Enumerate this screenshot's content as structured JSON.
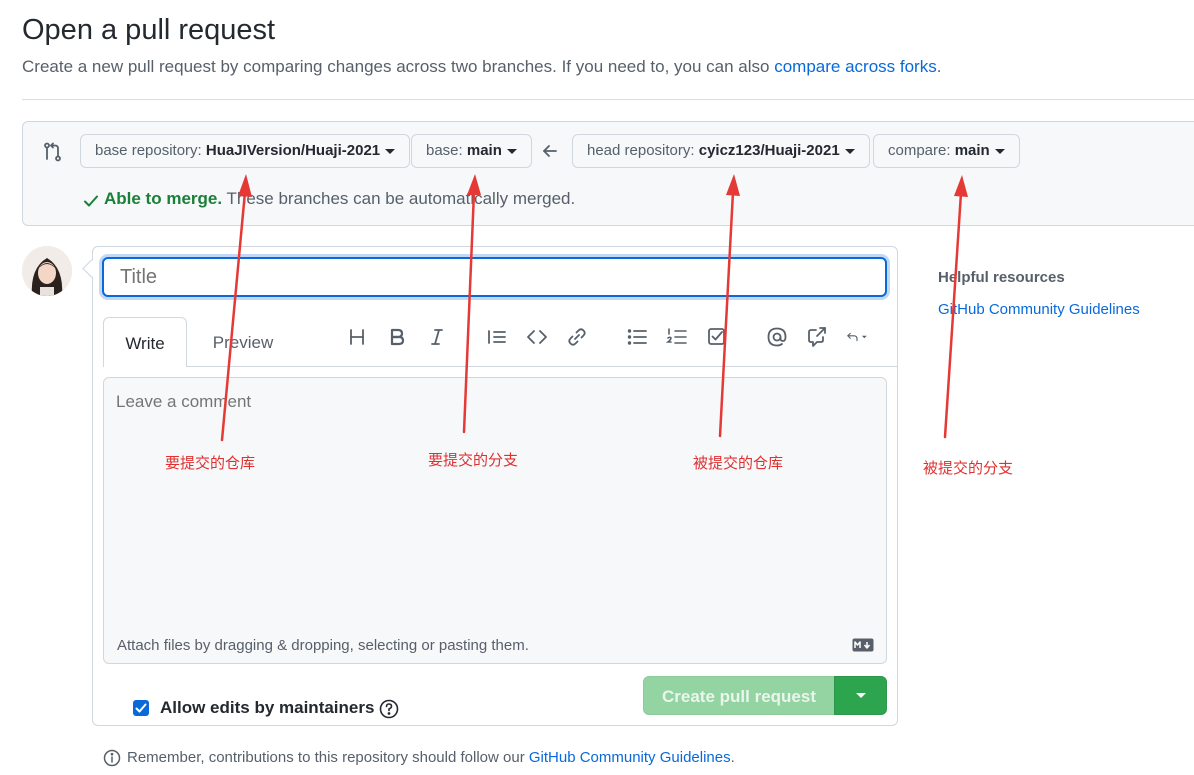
{
  "header": {
    "title": "Open a pull request",
    "subtitle": "Create a new pull request by comparing changes across two branches. If you need to, you can also ",
    "subtitle_link": "compare across forks",
    "subtitle_end": "."
  },
  "range": {
    "base_repo_label": "base repository: ",
    "base_repo_value": "HuaJIVersion/Huaji-2021",
    "base_label": "base: ",
    "base_value": "main",
    "head_repo_label": "head repository: ",
    "head_repo_value": "cyicz123/Huaji-2021",
    "compare_label": "compare: ",
    "compare_value": "main",
    "merge_ok": "Able to merge.",
    "merge_text": " These branches can be automatically merged."
  },
  "form": {
    "title_placeholder": "Title",
    "tabs": [
      "Write",
      "Preview"
    ],
    "toolbar_icons": [
      "heading-icon",
      "bold-icon",
      "italic-icon",
      "quote-icon",
      "code-icon",
      "link-icon",
      "bullet-list-icon",
      "numbered-list-icon",
      "task-list-icon",
      "mention-icon",
      "cross-reference-icon",
      "reply-icon"
    ],
    "comment_placeholder": "Leave a comment",
    "attach_text": "Attach files by dragging & dropping, selecting or pasting them.",
    "allow_edits_label": "Allow edits by maintainers",
    "allow_edits_checked": true,
    "create_button": "Create pull request"
  },
  "footer": {
    "remember_text": "Remember, contributions to this repository should follow our ",
    "remember_link": "GitHub Community Guidelines",
    "remember_end": "."
  },
  "sidebar": {
    "helpful_title": "Helpful resources",
    "helpful_link": "GitHub Community Guidelines"
  },
  "annotations": {
    "base_repo": "要提交的仓库",
    "base_branch": "要提交的分支",
    "head_repo": "被提交的仓库",
    "compare_branch": "被提交的分支"
  },
  "colors": {
    "link": "#0969da",
    "success": "#1a7f37",
    "button_disabled": "#94d3a2",
    "button_green": "#2da44e",
    "annotation": "#e03030"
  }
}
